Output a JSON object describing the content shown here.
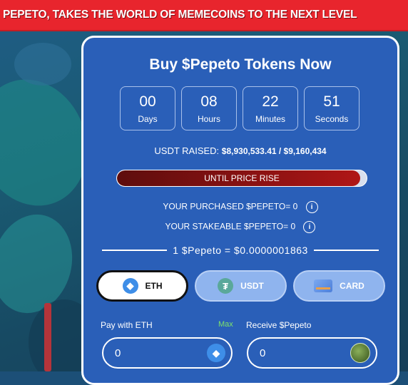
{
  "banner": {
    "text": "PEPETO, TAKES THE WORLD OF MEMECOINS TO THE NEXT LEVEL"
  },
  "card": {
    "title": "Buy $Pepeto Tokens Now",
    "timer": [
      {
        "value": "00",
        "label": "Days"
      },
      {
        "value": "08",
        "label": "Hours"
      },
      {
        "value": "22",
        "label": "Minutes"
      },
      {
        "value": "51",
        "label": "Seconds"
      }
    ],
    "raised_label": "USDT RAISED:",
    "raised_value": "$8,930,533.41 / $9,160,434",
    "progress_text": "UNTIL PRICE RISE",
    "progress_fraction": 0.975,
    "purchased": "YOUR PURCHASED $PEPETO= 0",
    "stakeable": "YOUR STAKEABLE $PEPETO= 0",
    "info_icon": "i",
    "rate": "1 $Pepeto = $0.0000001863",
    "tabs": [
      {
        "label": "ETH",
        "icon": "eth-icon"
      },
      {
        "label": "USDT",
        "icon": "usdt-icon"
      },
      {
        "label": "CARD",
        "icon": "card-icon"
      }
    ],
    "pay_label": "Pay with ETH",
    "max_label": "Max",
    "receive_label": "Receive $Pepeto",
    "pay_value": "0",
    "receive_value": "0"
  },
  "colors": {
    "banner": "#e8252d",
    "card": "#2a5fb8",
    "progress_fill": "#8d1212",
    "max": "#7ee26a"
  }
}
